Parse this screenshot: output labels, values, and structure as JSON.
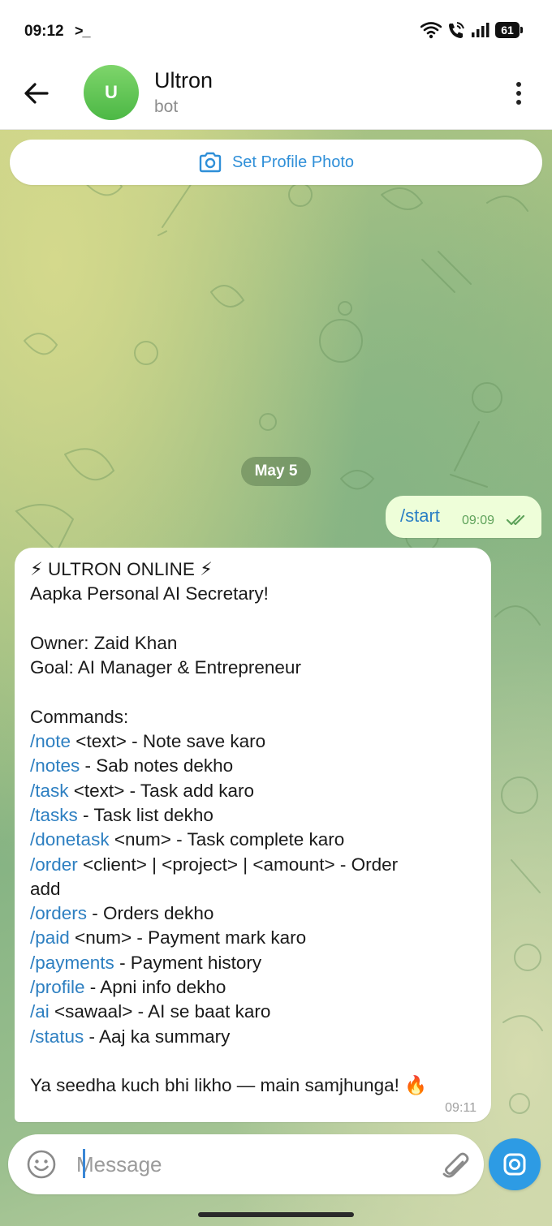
{
  "status_bar": {
    "time": "09:12",
    "terminal_glyph": ">_",
    "battery": "61"
  },
  "header": {
    "avatar_letter": "U",
    "title": "Ultron",
    "subtitle": "bot"
  },
  "set_profile_photo": {
    "label": "Set Profile Photo"
  },
  "date_separator": "May 5",
  "outgoing": {
    "text": "/start",
    "time": "09:09"
  },
  "incoming": {
    "time": "09:11",
    "lines": [
      {
        "plain": "⚡ ULTRON ONLINE ⚡"
      },
      {
        "plain": "Aapka Personal AI Secretary!"
      },
      {
        "plain": ""
      },
      {
        "plain": "Owner: Zaid Khan"
      },
      {
        "plain": "Goal: AI Manager & Entrepreneur"
      },
      {
        "plain": ""
      },
      {
        "plain": "Commands:"
      },
      {
        "cmd": "/note",
        "rest": " <text> - Note save karo"
      },
      {
        "cmd": "/notes",
        "rest": " - Sab notes dekho"
      },
      {
        "cmd": "/task",
        "rest": " <text> - Task add karo"
      },
      {
        "cmd": "/tasks",
        "rest": " - Task list dekho"
      },
      {
        "cmd": "/donetask",
        "rest": " <num> - Task complete karo"
      },
      {
        "cmd": "/order",
        "rest": " <client> | <project> | <amount> - Order"
      },
      {
        "plain": "add"
      },
      {
        "cmd": "/orders",
        "rest": " - Orders dekho"
      },
      {
        "cmd": "/paid",
        "rest": " <num> - Payment mark karo"
      },
      {
        "cmd": "/payments",
        "rest": " - Payment history"
      },
      {
        "cmd": "/profile",
        "rest": " - Apni info dekho"
      },
      {
        "cmd": "/ai",
        "rest": " <sawaal> - AI se baat karo"
      },
      {
        "cmd": "/status",
        "rest": " - Aaj ka summary"
      },
      {
        "plain": ""
      },
      {
        "plain": "Ya seedha kuch bhi likho — main samjhunga! 🔥"
      }
    ]
  },
  "composer": {
    "placeholder": "Message"
  },
  "colors": {
    "accent_blue": "#2d9be4",
    "command_link": "#2d7fc1",
    "outgoing_bubble": "#eefed9",
    "avatar_green": "#5cc04f"
  },
  "icons": [
    "back-arrow-icon",
    "more-vertical-icon",
    "camera-icon",
    "double-check-icon",
    "emoji-icon",
    "paperclip-icon",
    "wifi-icon",
    "wifi-call-icon",
    "signal-icon",
    "battery-icon"
  ]
}
